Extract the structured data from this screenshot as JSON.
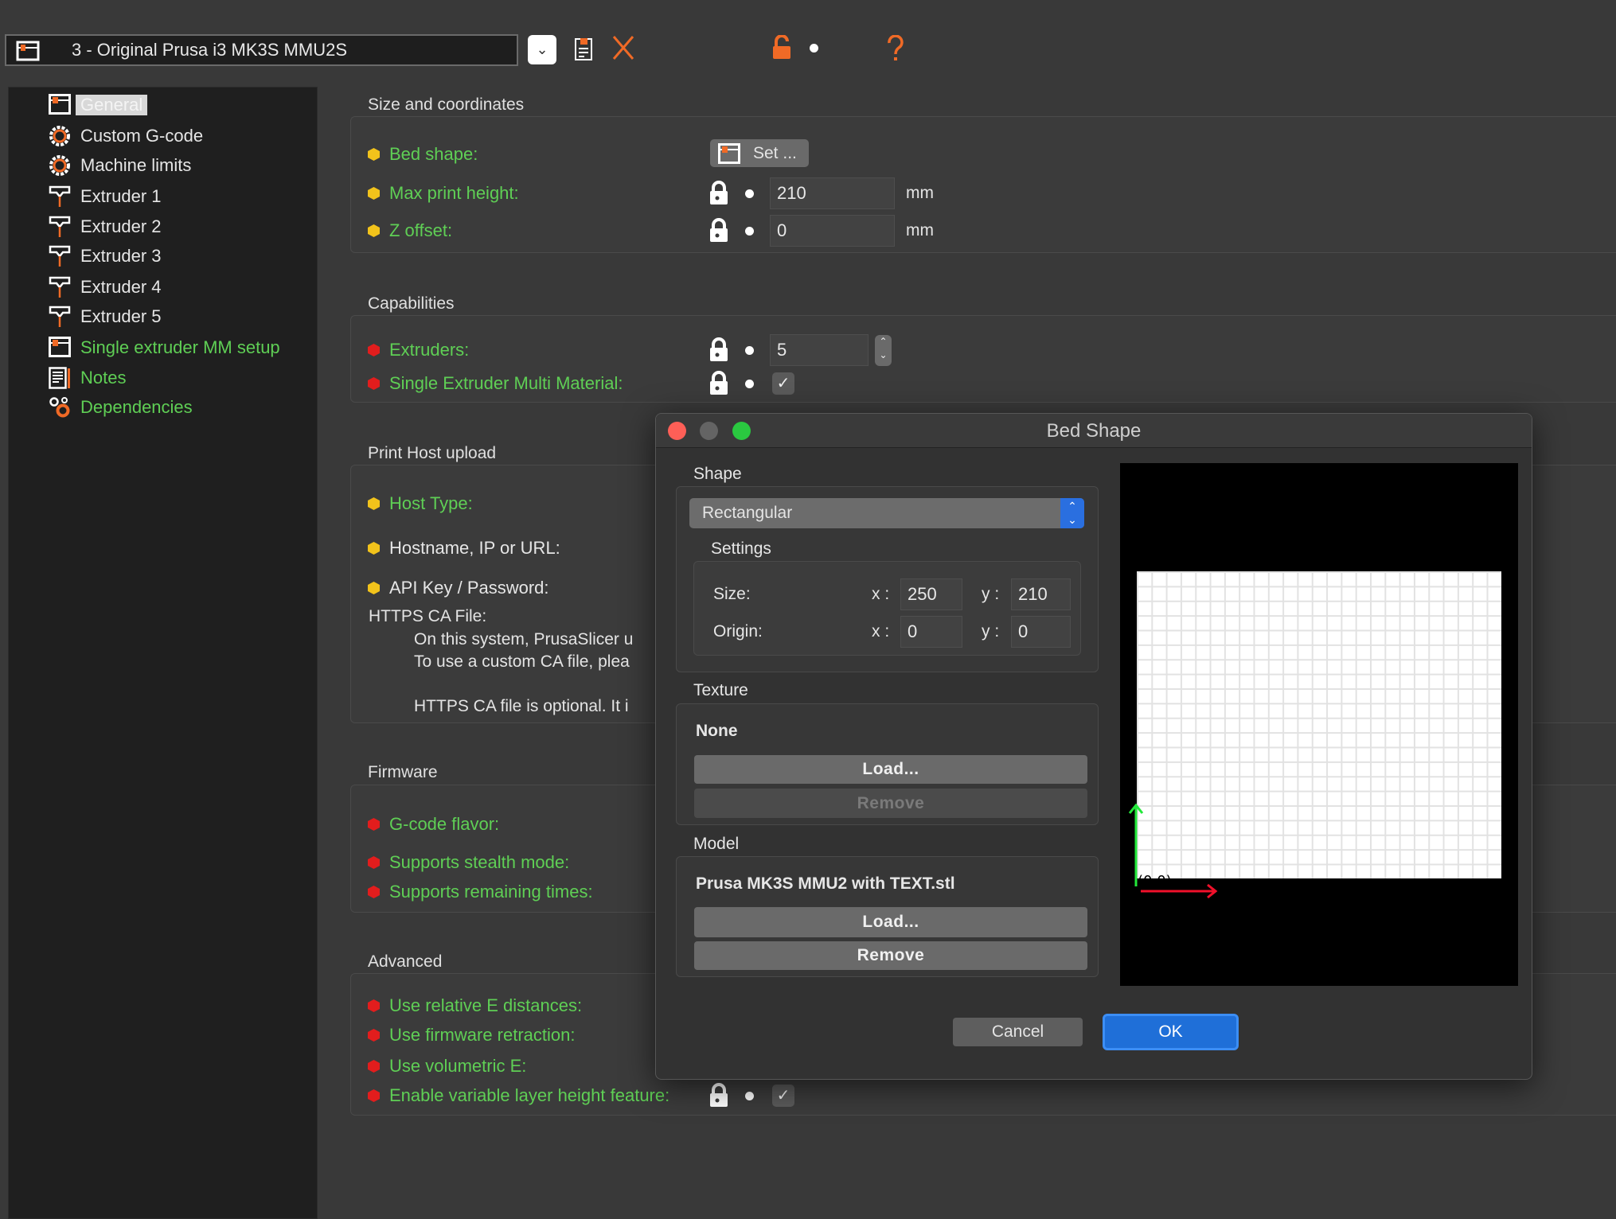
{
  "toolbar": {
    "preset": "3 - Original Prusa i3 MK3S MMU2S",
    "icons": [
      "printer-icon",
      "chevron-down-icon",
      "save-icon",
      "delete-x-icon",
      "lock-open-icon",
      "dot-icon",
      "question-icon"
    ]
  },
  "sidebar": {
    "items": [
      {
        "label": "General",
        "icon": "printer-icon",
        "selected": true
      },
      {
        "label": "Custom G-code",
        "icon": "cog-icon"
      },
      {
        "label": "Machine limits",
        "icon": "cog-icon"
      },
      {
        "label": "Extruder 1",
        "icon": "extruder-icon"
      },
      {
        "label": "Extruder 2",
        "icon": "extruder-icon"
      },
      {
        "label": "Extruder 3",
        "icon": "extruder-icon"
      },
      {
        "label": "Extruder 4",
        "icon": "extruder-icon"
      },
      {
        "label": "Extruder 5",
        "icon": "extruder-icon"
      },
      {
        "label": "Single extruder MM setup",
        "icon": "printer-icon",
        "green": true
      },
      {
        "label": "Notes",
        "icon": "notes-icon",
        "green": true
      },
      {
        "label": "Dependencies",
        "icon": "wrench-gears-icon",
        "green": true
      }
    ]
  },
  "sections": {
    "size": {
      "title": "Size and coordinates",
      "bed_shape": "Bed shape:",
      "set_button": "Set ...",
      "max_height": "Max print height:",
      "max_height_value": "210",
      "z_offset": "Z offset:",
      "z_offset_value": "0",
      "unit": "mm"
    },
    "capabilities": {
      "title": "Capabilities",
      "extruders": "Extruders:",
      "extruders_value": "5",
      "semm": "Single Extruder Multi Material:",
      "semm_checked": true
    },
    "host": {
      "title": "Print Host upload",
      "host_type": "Host Type:",
      "hostname": "Hostname, IP or URL:",
      "api_key": "API Key / Password:",
      "ca_file": "HTTPS CA File:",
      "line1": "On this system, PrusaSlicer u",
      "line2": "To use a custom CA file, plea",
      "line3": "HTTPS CA file is optional. It i"
    },
    "firmware": {
      "title": "Firmware",
      "gcode_flavor": "G-code flavor:",
      "stealth": "Supports stealth mode:",
      "remaining": "Supports remaining times:"
    },
    "advanced": {
      "title": "Advanced",
      "relative_e": "Use relative E distances:",
      "fw_retraction": "Use firmware retraction:",
      "volumetric": "Use volumetric E:",
      "variable_layer": "Enable variable layer height feature:",
      "variable_layer_checked": true
    }
  },
  "dialog": {
    "title": "Bed Shape",
    "shape_label": "Shape",
    "shape_value": "Rectangular",
    "settings_label": "Settings",
    "size_label": "Size:",
    "origin_label": "Origin:",
    "x_label": "x :",
    "y_label": "y :",
    "size_x": "250",
    "size_y": "210",
    "origin_x": "0",
    "origin_y": "0",
    "texture_label": "Texture",
    "texture_value": "None",
    "load": "Load...",
    "remove": "Remove",
    "model_label": "Model",
    "model_value": "Prusa MK3S MMU2 with TEXT.stl",
    "origin_marker": "(0,0)",
    "cancel": "Cancel",
    "ok": "OK"
  },
  "colors": {
    "green_label": "#5fcf55",
    "yellow_bullet": "#f2c31b",
    "red_bullet": "#e21d1d",
    "accent_orange": "#f06a26",
    "ok_blue": "#1f6fd8"
  }
}
